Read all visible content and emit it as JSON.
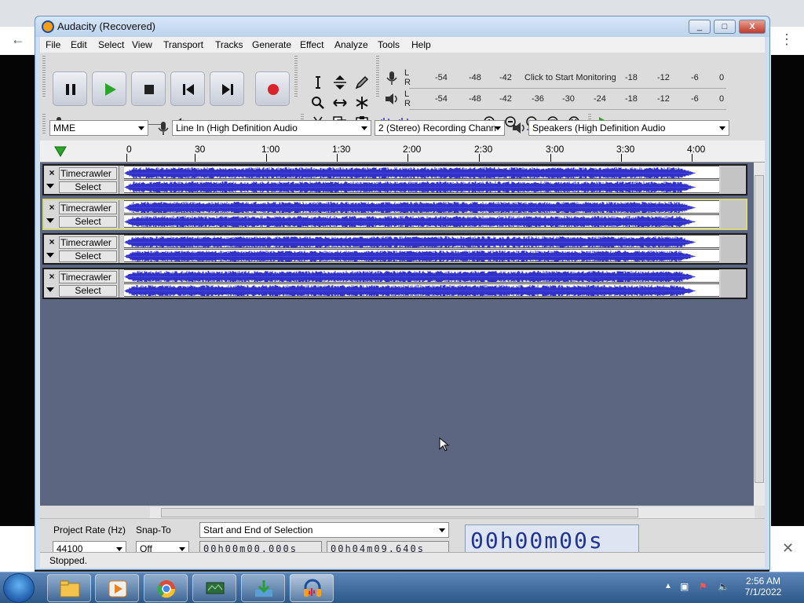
{
  "window": {
    "title": "Audacity (Recovered)",
    "minimize": "_",
    "maximize": "□",
    "close": "X"
  },
  "menu": [
    "File",
    "Edit",
    "Select",
    "View",
    "Transport",
    "Tracks",
    "Generate",
    "Effect",
    "Analyze",
    "Tools",
    "Help"
  ],
  "meters": {
    "record_ticks": [
      "-54",
      "-48",
      "-42",
      "-18",
      "-12",
      "-6",
      "0"
    ],
    "record_hint": "Click to Start Monitoring",
    "play_ticks": [
      "-54",
      "-48",
      "-42",
      "-36",
      "-30",
      "-24",
      "-18",
      "-12",
      "-6",
      "0"
    ],
    "lr": [
      "L",
      "R"
    ]
  },
  "devices": {
    "host": "MME",
    "recording_device": "Line In (High Definition Audio",
    "channels": "2 (Stereo) Recording Chann",
    "playback_device": "Speakers (High Definition Audio"
  },
  "ruler": {
    "labels": [
      "0",
      "30",
      "1:00",
      "1:30",
      "2:00",
      "2:30",
      "3:00",
      "3:30",
      "4:00"
    ]
  },
  "tracks": [
    {
      "name": "Timecrawler",
      "select_label": "Select",
      "close": "×",
      "selected": false
    },
    {
      "name": "Timecrawler",
      "select_label": "Select",
      "close": "×",
      "selected": true
    },
    {
      "name": "Timecrawler",
      "select_label": "Select",
      "close": "×",
      "selected": false
    },
    {
      "name": "Timecrawler",
      "select_label": "Select",
      "close": "×",
      "selected": false
    }
  ],
  "selection_toolbar": {
    "project_rate_label": "Project Rate (Hz)",
    "project_rate_value": "44100",
    "snap_to_label": "Snap-To",
    "snap_to_value": "Off",
    "selection_mode": "Start and End of Selection",
    "start_time": "00h00m00.000s",
    "end_time": "00h04m09.640s",
    "audio_position": "00h00m00s"
  },
  "status": "Stopped.",
  "taskbar": {
    "time": "2:56 AM",
    "date": "7/1/2022"
  },
  "colors": {
    "waveform": "#3232c8",
    "track_bg": "#5c6680",
    "record": "#d8242a",
    "play": "#2aa72a"
  }
}
